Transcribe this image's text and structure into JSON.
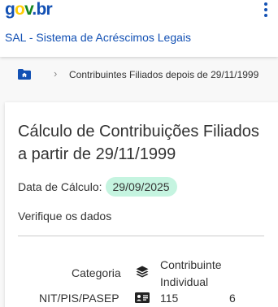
{
  "header": {
    "logo": {
      "g": "g",
      "o": "o",
      "v": "v",
      "dot": ".",
      "b": "b",
      "r": "r"
    },
    "system_title": "SAL - Sistema de Acréscimos Legais"
  },
  "breadcrumb": {
    "current": "Contribuintes Filiados depois de 29/11/1999"
  },
  "card": {
    "title": "Cálculo de Contribuições Filiados a partir de 29/11/1999",
    "calc_date_label": "Data de Cálculo:",
    "calc_date_value": "29/09/2025",
    "verify_label": "Verifique os dados",
    "fields": {
      "categoria_label": "Categoria",
      "categoria_value_line1": "Contribuinte",
      "categoria_value_line2": "Individual",
      "nit_label": "NIT/PIS/PASEP",
      "nit_value_part1": "115",
      "nit_value_part2": "6"
    }
  },
  "colors": {
    "brand_blue": "#1351b4",
    "brand_yellow": "#ffcd07",
    "brand_green": "#168821",
    "date_pill_bg": "#c5f4e0"
  },
  "icons": {
    "home": "folder-home-icon",
    "menu": "kebab-menu-icon",
    "chevron": "chevron-right-icon",
    "layers": "layers-icon",
    "id_card": "id-card-icon"
  }
}
